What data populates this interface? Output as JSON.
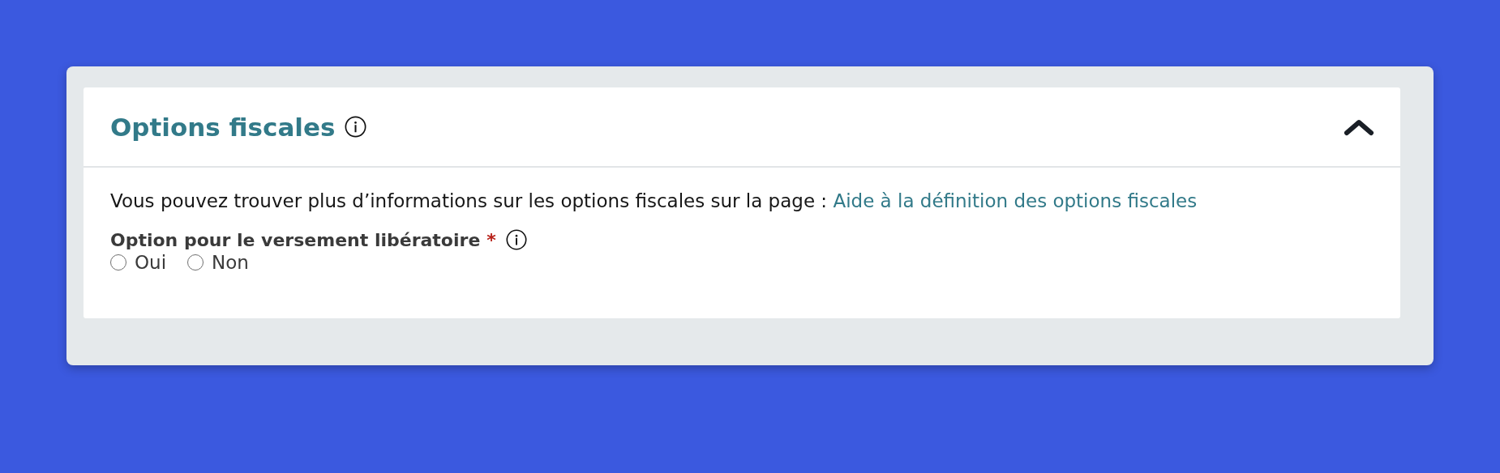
{
  "section": {
    "title": "Options fiscales",
    "expanded": true,
    "intro": "Vous pouvez trouver plus d’informations sur les options fiscales sur la page : ",
    "intro_link": "Aide à la définition des options fiscales",
    "field": {
      "label": "Option pour le versement libératoire",
      "required_mark": "*",
      "required": true,
      "options": [
        {
          "label": "Oui",
          "selected": false
        },
        {
          "label": "Non",
          "selected": false
        }
      ]
    }
  }
}
